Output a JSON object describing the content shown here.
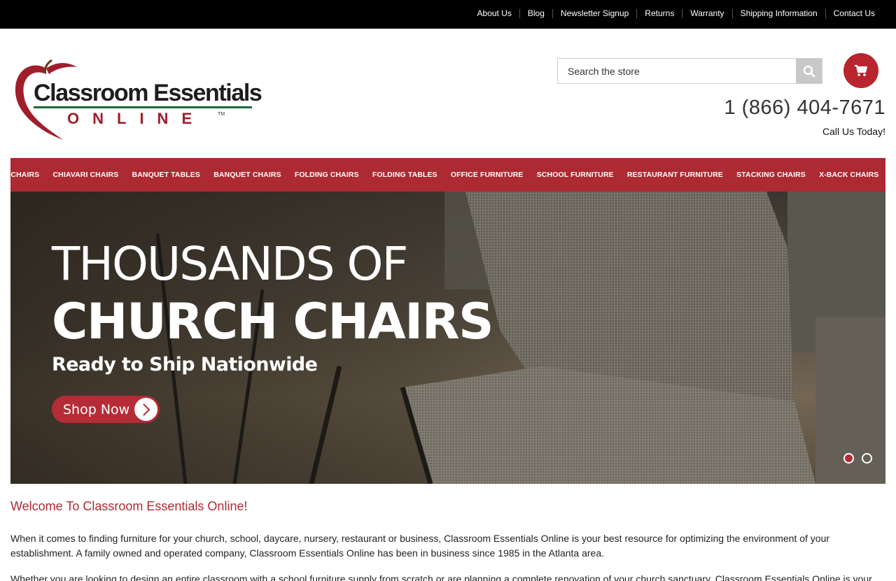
{
  "topbar": {
    "links": [
      "About Us",
      "Blog",
      "Newsletter Signup",
      "Returns",
      "Warranty",
      "Shipping Information",
      "Contact Us"
    ]
  },
  "logo": {
    "line1": "Classroom Essentials",
    "line2": "ONLINE",
    "tm": "TM",
    "icon": "apple-heart-logo"
  },
  "search": {
    "placeholder": "Search the store",
    "icon": "search-icon"
  },
  "cart": {
    "icon": "shopping-cart-icon"
  },
  "contact": {
    "phone": "1 (866) 404-7671",
    "tagline": "Call Us Today!"
  },
  "nav": {
    "items": [
      "CHURCH CHAIRS",
      "CHIAVARI CHAIRS",
      "BANQUET TABLES",
      "BANQUET CHAIRS",
      "FOLDING CHAIRS",
      "FOLDING TABLES",
      "OFFICE FURNITURE",
      "SCHOOL FURNITURE",
      "RESTAURANT FURNITURE",
      "STACKING CHAIRS",
      "X-BACK CHAIRS"
    ]
  },
  "hero": {
    "line1": "THOUSANDS OF",
    "line2": "CHURCH CHAIRS",
    "line3": "Ready to Ship Nationwide",
    "cta": "Shop Now",
    "slides": 2,
    "active_slide": 1
  },
  "content": {
    "welcome": "Welcome To Classroom Essentials Online!",
    "paragraph1": "When it comes to finding furniture for your church, school, daycare, nursery, restaurant or business, Classroom Essentials Online is your best resource for optimizing the environment of your establishment. A family owned and operated company, Classroom Essentials Online has been in business since 1985 in the Atlanta area.",
    "paragraph2": "Whether you are looking to design an entire classroom with a school furniture supply from scratch or are planning a complete renovation of your church sanctuary, Classroom Essentials Online is your"
  },
  "colors": {
    "brand_red": "#ad2a33",
    "topbar": "#000000",
    "logo_green": "#1b6b3a"
  }
}
